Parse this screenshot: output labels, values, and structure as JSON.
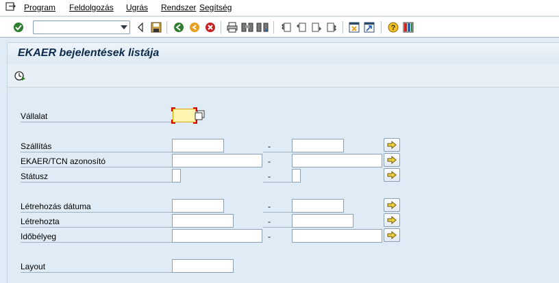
{
  "menu": {
    "items": [
      "Program",
      "Feldolgozás",
      "Ugrás",
      "Rendszer",
      "Segítség"
    ]
  },
  "toolbar": {
    "command_value": "",
    "icons": [
      "enter-icon",
      "back-icon",
      "save-icon",
      "back-nav-icon",
      "exit-icon",
      "cancel-icon",
      "print-icon",
      "find-icon",
      "find-next-icon",
      "first-page-icon",
      "prev-page-icon",
      "next-page-icon",
      "last-page-icon",
      "new-session-icon",
      "shortcut-icon",
      "help-icon",
      "layout-icon"
    ]
  },
  "page": {
    "title": "EKAER bejelentések listája"
  },
  "form": {
    "dash": "-",
    "fields": {
      "company": {
        "label": "Vállalat",
        "value": ""
      },
      "delivery": {
        "label": "Szállítás",
        "from": "",
        "to": ""
      },
      "ekaer_id": {
        "label": "EKAER/TCN azonosító",
        "from": "",
        "to": ""
      },
      "status": {
        "label": "Státusz",
        "from": "",
        "to": ""
      },
      "created_date": {
        "label": "Létrehozás dátuma",
        "from": "",
        "to": ""
      },
      "created_by": {
        "label": "Létrehozta",
        "from": "",
        "to": ""
      },
      "timestamp": {
        "label": "Időbélyeg",
        "from": "",
        "to": ""
      },
      "layout": {
        "label": "Layout",
        "value": ""
      }
    }
  }
}
